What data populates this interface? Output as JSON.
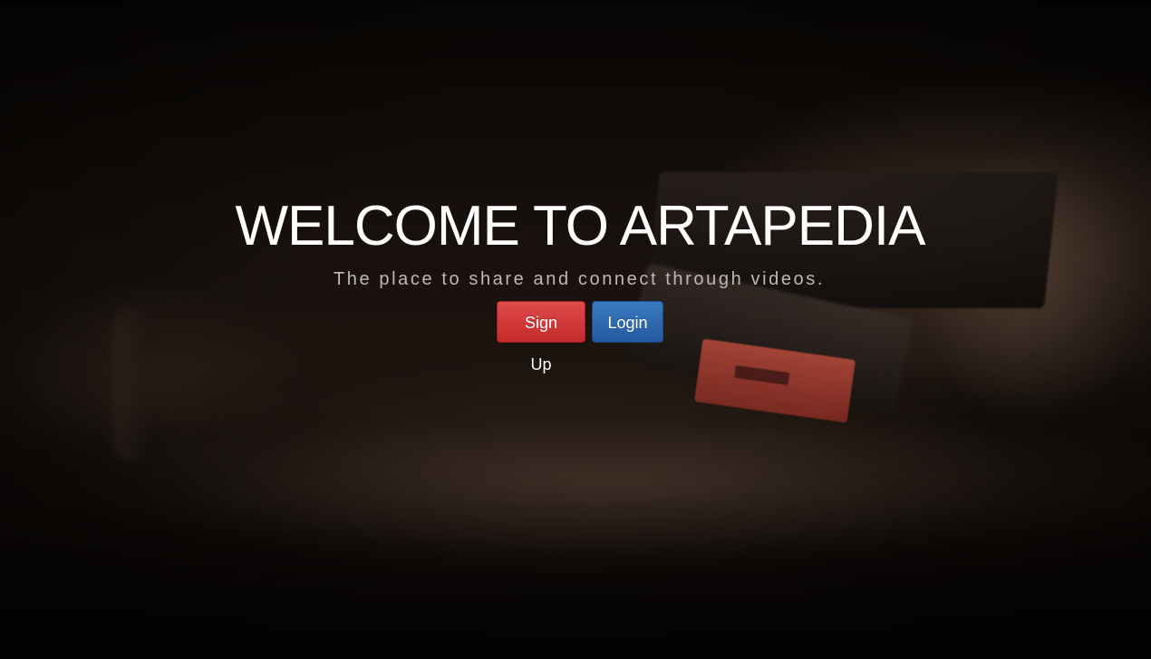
{
  "hero": {
    "title": "WELCOME TO ARTAPEDIA",
    "subtitle": "The place to share and connect through videos.",
    "background_image": "turntable-tonearm-photo"
  },
  "actions": {
    "signup_label": "Sign Up",
    "login_label": "Login"
  },
  "colors": {
    "signup_button": "#d9534f",
    "login_button": "#337ab7",
    "title_text": "#ffffff",
    "subtitle_text": "#bfb8b3"
  }
}
